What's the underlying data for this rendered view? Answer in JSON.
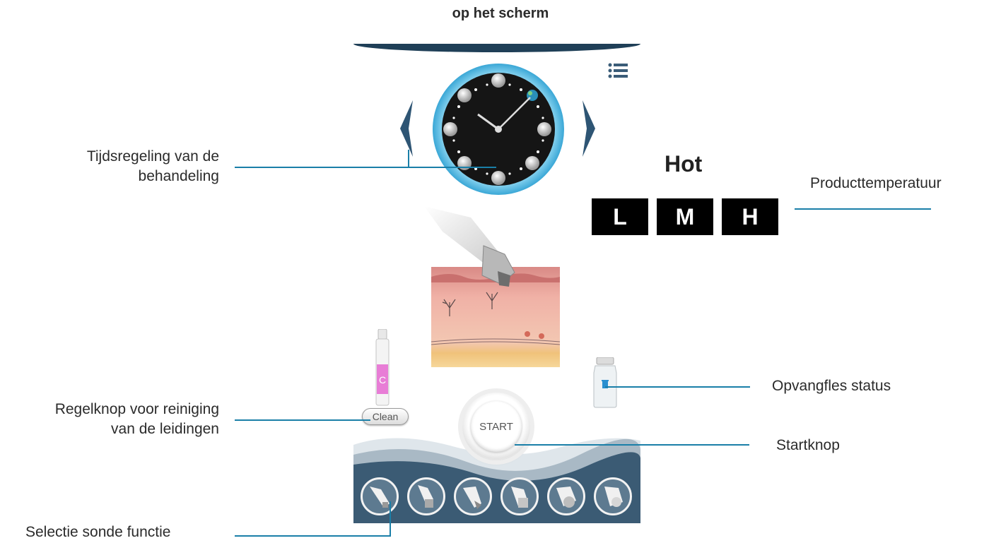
{
  "page": {
    "title": "op het scherm"
  },
  "annotations": {
    "time_control": [
      "Tijdsregeling van de",
      "behandeling"
    ],
    "product_temperature": "Producttemperatuur",
    "cleaning": [
      "Regelknop voor reiniging",
      "van de leidingen"
    ],
    "probe_selection": "Selectie sonde functie",
    "bottle_status": "Opvangfles status",
    "start_button": "Startknop"
  },
  "screen": {
    "temperature_label": "Hot",
    "temperature_levels": [
      "L",
      "M",
      "H"
    ],
    "clean_label": "Clean",
    "start_label": "START",
    "vial_letter": "C",
    "probes": [
      "probe-1",
      "probe-2",
      "probe-3",
      "probe-4",
      "probe-5",
      "probe-6"
    ]
  },
  "colors": {
    "accent_line": "#1a7fa8",
    "panel_dark": "#1f3f57",
    "clock_ring": "#5bc0e8",
    "vial_pink": "#e87dd6"
  }
}
